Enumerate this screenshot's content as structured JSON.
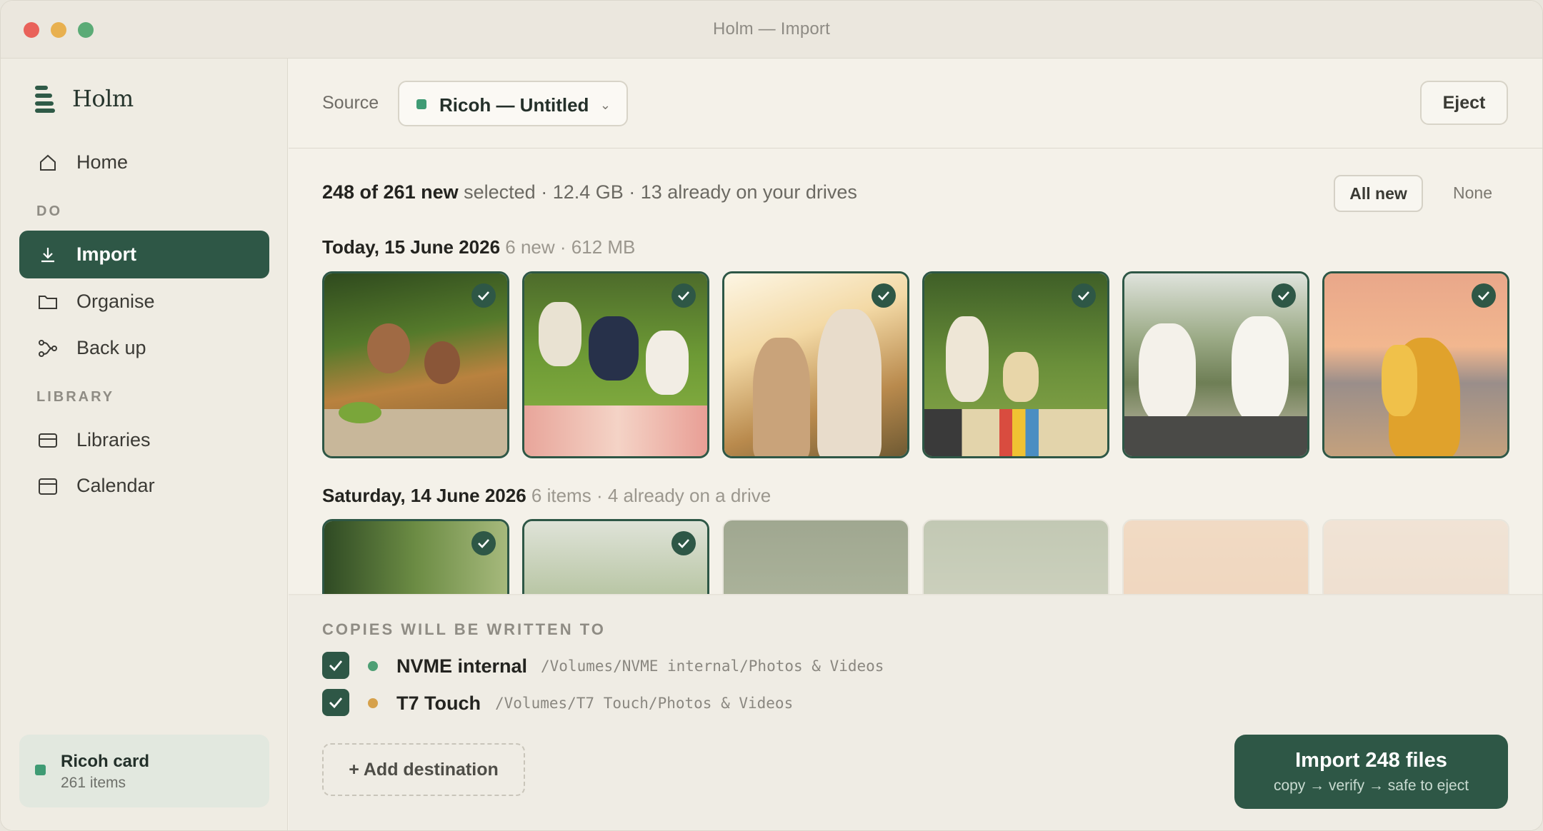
{
  "window": {
    "title": "Holm — Import"
  },
  "sidebar": {
    "app_name": "Holm",
    "home_label": "Home",
    "section_do": "DO",
    "section_library": "LIBRARY",
    "items": [
      {
        "label": "Import",
        "icon": "download-icon",
        "active": true
      },
      {
        "label": "Organise",
        "icon": "folder-icon",
        "active": false
      },
      {
        "label": "Back up",
        "icon": "branch-icon",
        "active": false
      },
      {
        "label": "Libraries",
        "icon": "library-icon",
        "active": false
      },
      {
        "label": "Calendar",
        "icon": "calendar-icon",
        "active": false
      }
    ],
    "card": {
      "name": "Ricoh card",
      "count": "261 items"
    }
  },
  "toolbar": {
    "source_label": "Source",
    "source_value": "Ricoh — Untitled",
    "eject_label": "Eject"
  },
  "selection": {
    "count_text": "248 of 261 new",
    "selected_word": " selected",
    "size": "12.4 GB",
    "already": "13 already on your drives",
    "all_new_label": "All new",
    "none_label": "None"
  },
  "groups": [
    {
      "date": "Today, 15 June 2026",
      "meta_a": "6 new",
      "meta_b": "612 MB"
    },
    {
      "date": "Saturday, 14 June 2026",
      "meta_a": "6 items",
      "meta_b": "4 already on a drive"
    }
  ],
  "destinations": {
    "title": "COPIES WILL BE WRITTEN TO",
    "items": [
      {
        "name": "NVME internal",
        "path": "/Volumes/NVME internal/Photos & Videos",
        "color": "#4e9f74",
        "checked": true
      },
      {
        "name": "T7 Touch",
        "path": "/Volumes/T7 Touch/Photos & Videos",
        "color": "#d6a14b",
        "checked": true
      }
    ],
    "add_label": "+ Add destination"
  },
  "import_button": {
    "label": "Import 248 files",
    "sub": "copy → verify → safe to eject"
  },
  "colors": {
    "accent": "#2e5746",
    "source_dot": "#3f9b74"
  }
}
